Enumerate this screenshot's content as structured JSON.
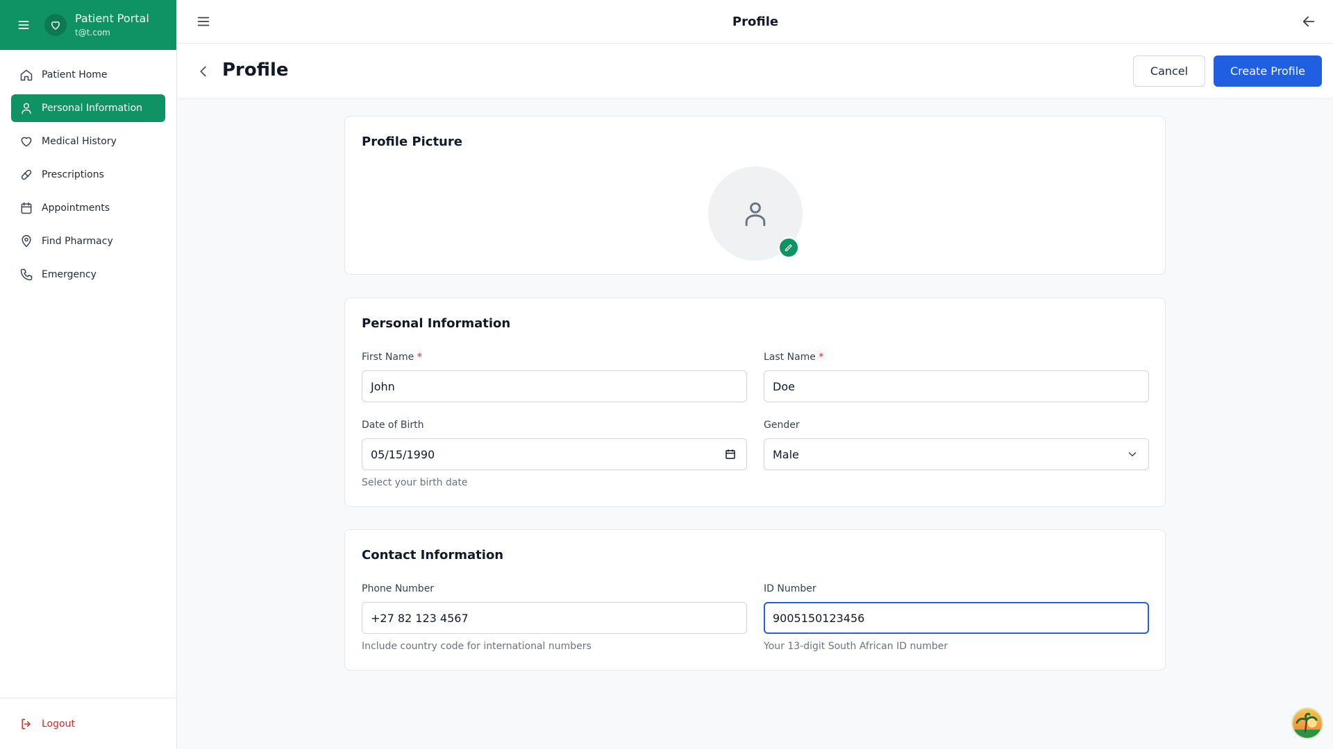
{
  "sidebar": {
    "app_name": "Patient Portal",
    "user_email": "t@t.com",
    "items": [
      {
        "label": "Patient Home",
        "icon": "home-icon"
      },
      {
        "label": "Personal Information",
        "icon": "user-icon",
        "active": true
      },
      {
        "label": "Medical History",
        "icon": "heart-icon"
      },
      {
        "label": "Prescriptions",
        "icon": "pill-icon"
      },
      {
        "label": "Appointments",
        "icon": "calendar-icon"
      },
      {
        "label": "Find Pharmacy",
        "icon": "map-pin-icon"
      },
      {
        "label": "Emergency",
        "icon": "phone-icon"
      }
    ],
    "logout_label": "Logout"
  },
  "topbar": {
    "title": "Profile"
  },
  "page": {
    "title": "Profile",
    "cancel_label": "Cancel",
    "create_label": "Create Profile"
  },
  "profile_picture": {
    "title": "Profile Picture"
  },
  "personal": {
    "title": "Personal Information",
    "first_name_label": "First Name",
    "first_name_value": "John",
    "last_name_label": "Last Name",
    "last_name_value": "Doe",
    "dob_label": "Date of Birth",
    "dob_value": "05/15/1990",
    "dob_help": "Select your birth date",
    "gender_label": "Gender",
    "gender_value": "Male",
    "required_mark": "*"
  },
  "contact": {
    "title": "Contact Information",
    "phone_label": "Phone Number",
    "phone_value": "+27 82 123 4567",
    "phone_help": "Include country code for international numbers",
    "id_label": "ID Number",
    "id_value": "9005150123456",
    "id_help": "Your 13-digit South African ID number"
  },
  "colors": {
    "brand_green": "#0f9365",
    "primary_blue": "#1f5fe0",
    "danger_red": "#dc2626"
  }
}
